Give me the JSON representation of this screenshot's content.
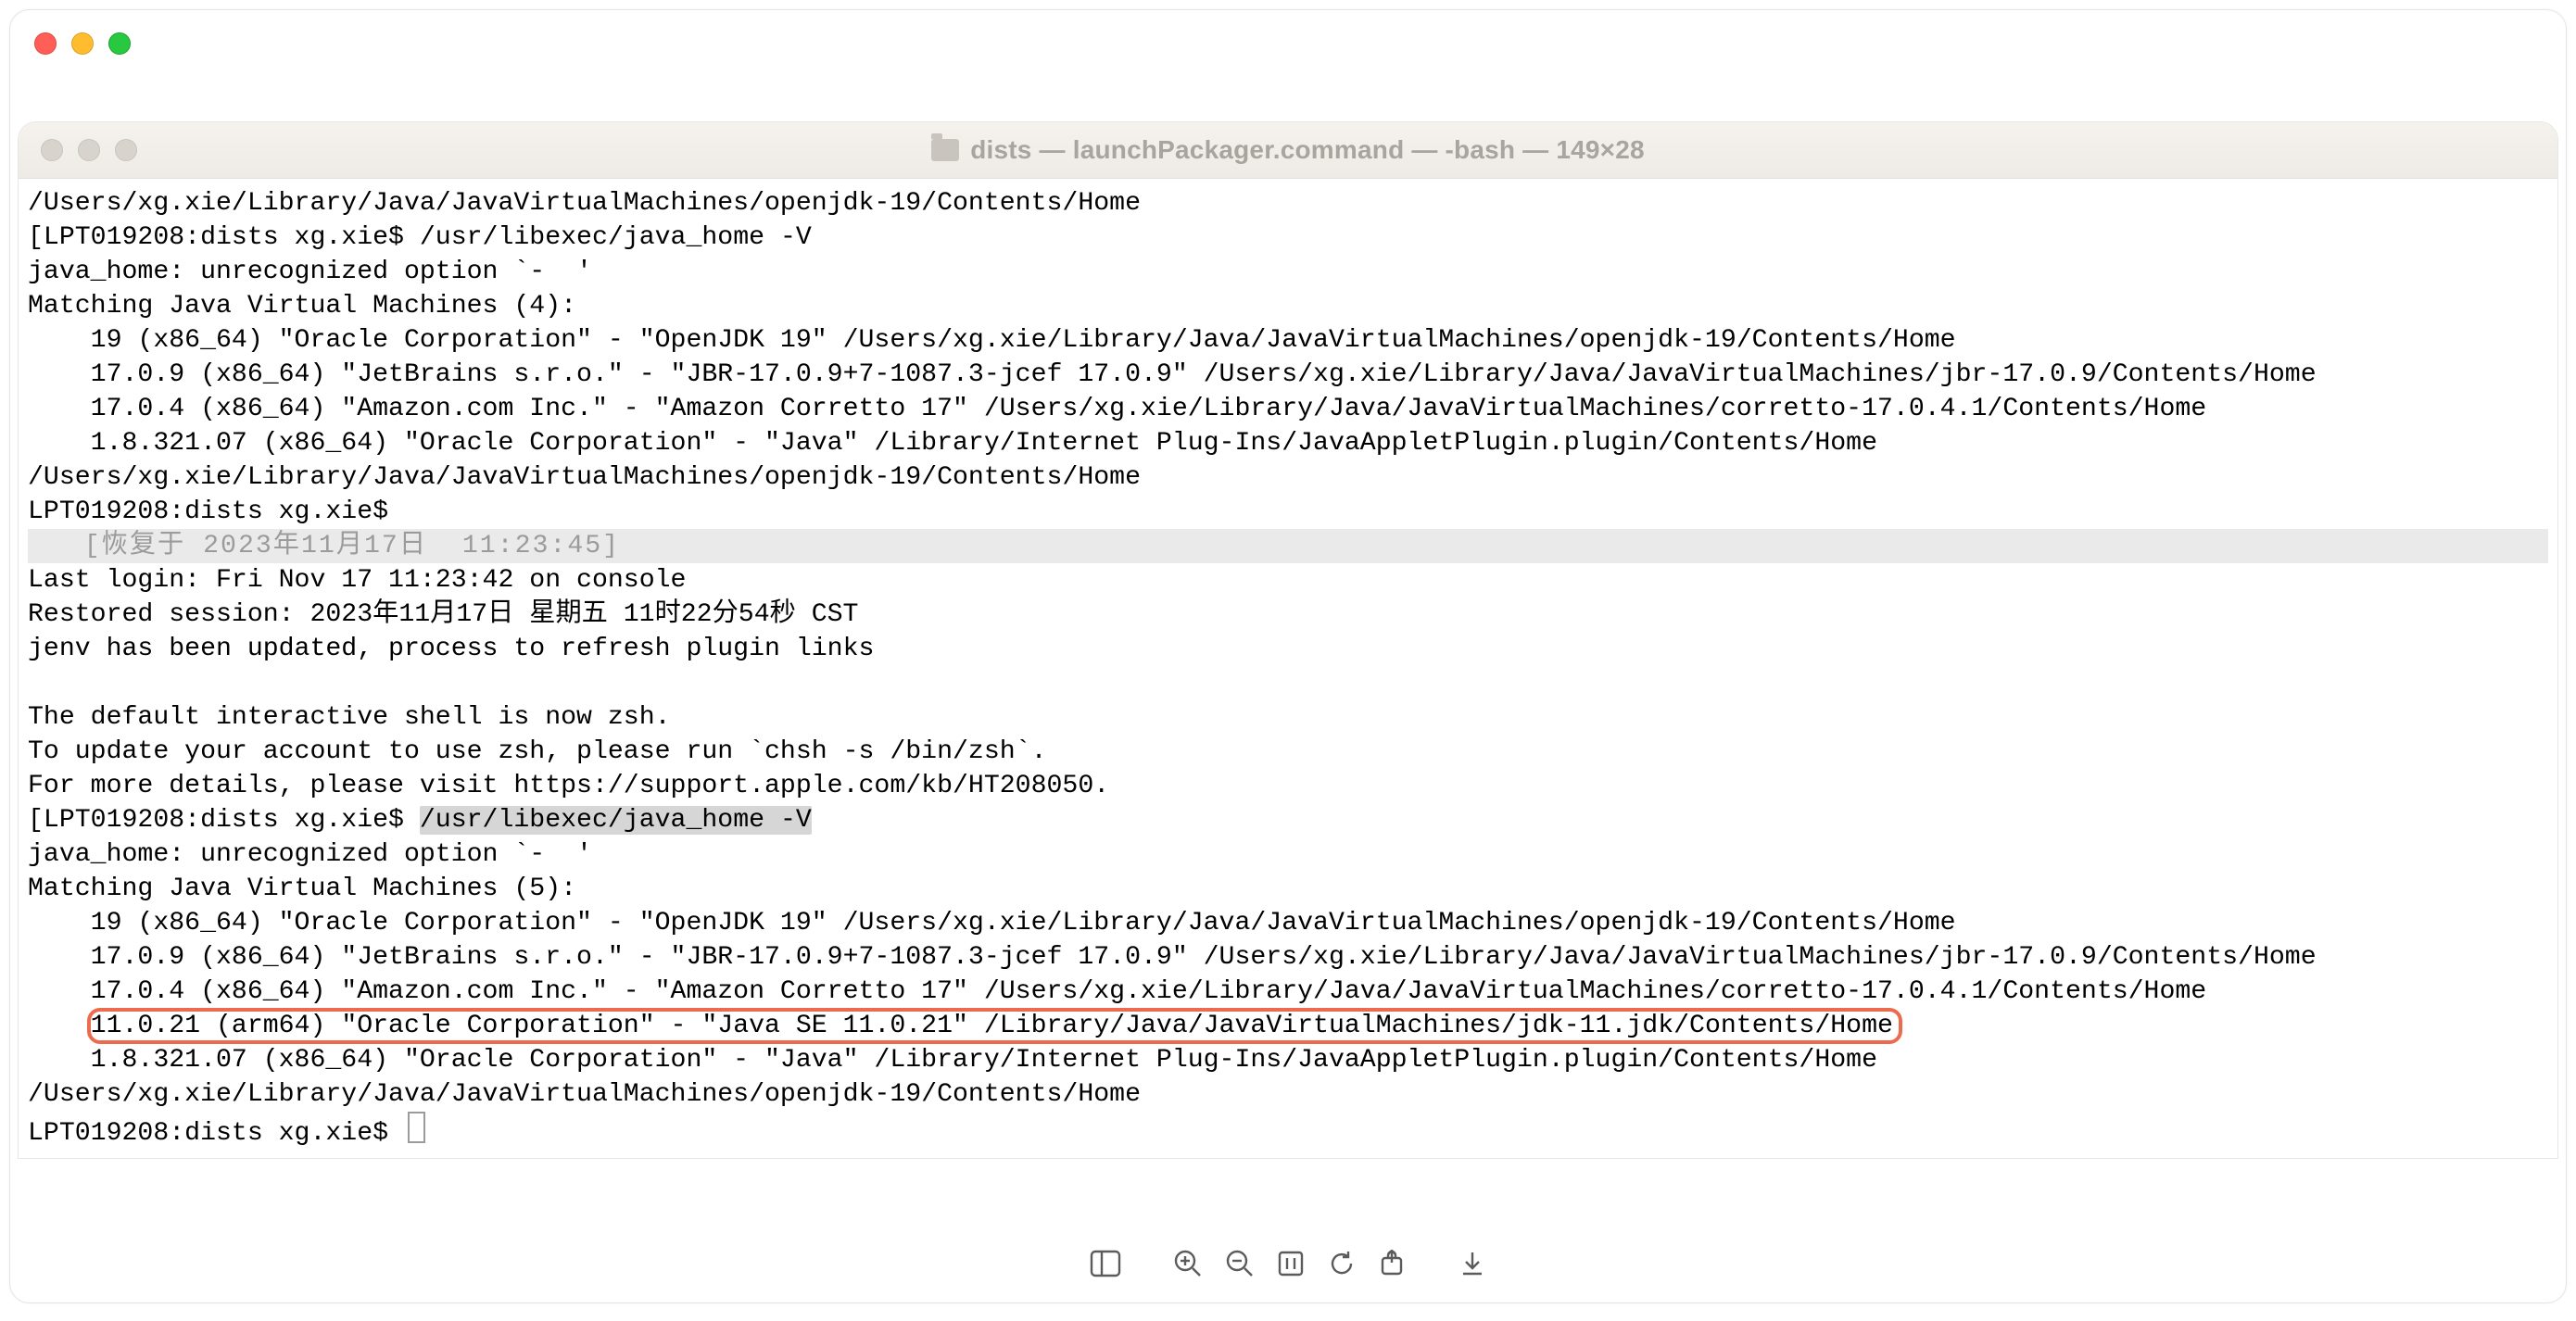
{
  "terminal": {
    "title": "dists — launchPackager.command — -bash — 149×28",
    "lines": {
      "l01": "/Users/xg.xie/Library/Java/JavaVirtualMachines/openjdk-19/Contents/Home",
      "l02_prompt": "[LPT019208:dists xg.xie$ ",
      "l02_cmd": "/usr/libexec/java_home -V",
      "l03": "java_home: unrecognized option `-  '",
      "l04": "Matching Java Virtual Machines (4):",
      "l05": "    19 (x86_64) \"Oracle Corporation\" - \"OpenJDK 19\" /Users/xg.xie/Library/Java/JavaVirtualMachines/openjdk-19/Contents/Home",
      "l06": "    17.0.9 (x86_64) \"JetBrains s.r.o.\" - \"JBR-17.0.9+7-1087.3-jcef 17.0.9\" /Users/xg.xie/Library/Java/JavaVirtualMachines/jbr-17.0.9/Contents/Home",
      "l07": "    17.0.4 (x86_64) \"Amazon.com Inc.\" - \"Amazon Corretto 17\" /Users/xg.xie/Library/Java/JavaVirtualMachines/corretto-17.0.4.1/Contents/Home",
      "l08": "    1.8.321.07 (x86_64) \"Oracle Corporation\" - \"Java\" /Library/Internet Plug-Ins/JavaAppletPlugin.plugin/Contents/Home",
      "l09": "/Users/xg.xie/Library/Java/JavaVirtualMachines/openjdk-19/Contents/Home",
      "l10": "LPT019208:dists xg.xie$",
      "restore_banner": "   [恢复于 2023年11月17日  11:23:45]",
      "l12": "Last login: Fri Nov 17 11:23:42 on console",
      "l13": "Restored session: 2023年11月17日 星期五 11时22分54秒 CST",
      "l14": "jenv has been updated, process to refresh plugin links",
      "blank": " ",
      "l16": "The default interactive shell is now zsh.",
      "l17": "To update your account to use zsh, please run `chsh -s /bin/zsh`.",
      "l18": "For more details, please visit https://support.apple.com/kb/HT208050.",
      "l19_prompt": "[LPT019208:dists xg.xie$ ",
      "l19_cmd": "/usr/libexec/java_home -V",
      "l20": "java_home: unrecognized option `-  '",
      "l21": "Matching Java Virtual Machines (5):",
      "l22": "    19 (x86_64) \"Oracle Corporation\" - \"OpenJDK 19\" /Users/xg.xie/Library/Java/JavaVirtualMachines/openjdk-19/Contents/Home",
      "l23": "    17.0.9 (x86_64) \"JetBrains s.r.o.\" - \"JBR-17.0.9+7-1087.3-jcef 17.0.9\" /Users/xg.xie/Library/Java/JavaVirtualMachines/jbr-17.0.9/Contents/Home",
      "l24": "    17.0.4 (x86_64) \"Amazon.com Inc.\" - \"Amazon Corretto 17\" /Users/xg.xie/Library/Java/JavaVirtualMachines/corretto-17.0.4.1/Contents/Home",
      "l25_indent": "    ",
      "l25_hl": "11.0.21 (arm64) \"Oracle Corporation\" - \"Java SE 11.0.21\" /Library/Java/JavaVirtualMachines/jdk-11.jdk/Contents/Home",
      "l26": "    1.8.321.07 (x86_64) \"Oracle Corporation\" - \"Java\" /Library/Internet Plug-Ins/JavaAppletPlugin.plugin/Contents/Home",
      "l27": "/Users/xg.xie/Library/Java/JavaVirtualMachines/openjdk-19/Contents/Home",
      "l28": "LPT019208:dists xg.xie$ "
    }
  }
}
